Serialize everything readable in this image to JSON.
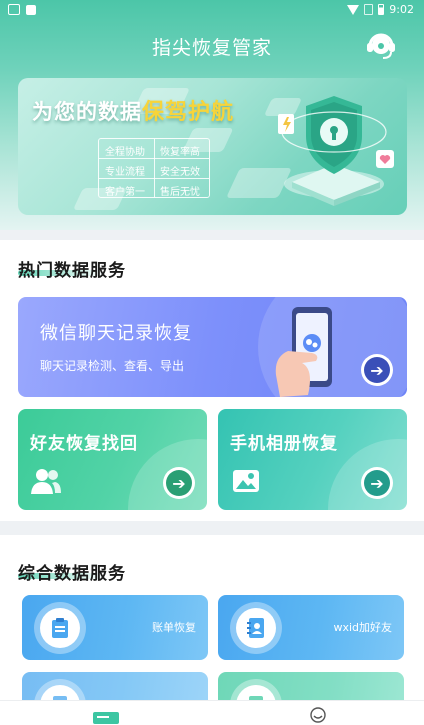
{
  "app": {
    "title": "指尖恢复管家"
  },
  "status_bar": {
    "time": "9:02"
  },
  "banner": {
    "title_plain": "为您的数据",
    "title_highlight": "保驾护航",
    "tags": [
      "全程协助",
      "恢复率高",
      "专业流程",
      "安全无效",
      "客户第一",
      "售后无忧"
    ]
  },
  "hot_section": {
    "title": "热门数据服务",
    "wechat_card": {
      "title": "微信聊天记录恢复",
      "subtitle": "聊天记录检测、查看、导出"
    },
    "friend_card": {
      "title": "好友恢复找回"
    },
    "album_card": {
      "title": "手机相册恢复"
    }
  },
  "general_section": {
    "title": "综合数据服务",
    "items": [
      {
        "label": "账单恢复",
        "icon": "bill-icon"
      },
      {
        "label": "wxid加好友",
        "icon": "contact-book-icon"
      },
      {
        "label": "",
        "icon": "document-icon"
      },
      {
        "label": "",
        "icon": "file-icon"
      }
    ]
  },
  "tabbar": {
    "items": [
      {
        "icon": "home-icon"
      },
      {
        "icon": "profile-icon"
      }
    ]
  },
  "colors": {
    "brand_green": "#4cc6a8",
    "wechat_card_blue": "#7d90fb",
    "green_card_bg": "#45cea2",
    "teal_card_bg": "#3cc9b4",
    "mini_card_blue": "#4aa7f0",
    "highlight_yellow": "#f7d43a"
  }
}
